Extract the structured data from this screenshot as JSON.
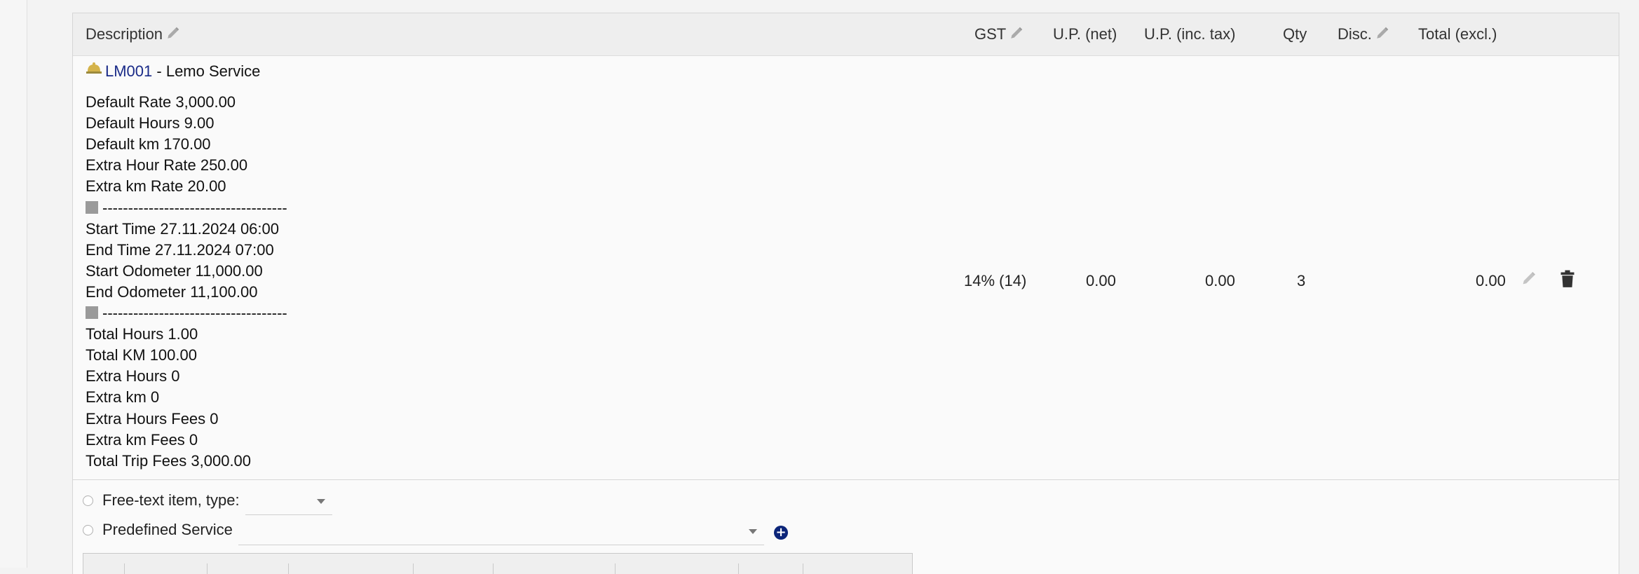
{
  "table": {
    "headers": {
      "description": "Description",
      "gst": "GST",
      "up_net": "U.P. (net)",
      "up_inc_tax": "U.P. (inc. tax)",
      "qty": "Qty",
      "disc": "Disc.",
      "total_excl": "Total (excl.)"
    },
    "row": {
      "product_code": "LM001",
      "product_name": " - Lemo Service",
      "details_1": [
        "Default Rate 3,000.00",
        "Default Hours 9.00",
        "Default km 170.00",
        "Extra Hour Rate 250.00",
        "Extra km Rate 20.00"
      ],
      "separator": "------------------------------------",
      "details_2": [
        "Start Time 27.11.2024 06:00",
        "End Time 27.11.2024 07:00",
        "Start Odometer 11,000.00",
        "End Odometer 11,100.00"
      ],
      "details_3": [
        "Total Hours 1.00",
        "Total KM 100.00",
        "Extra Hours 0",
        "Extra km 0",
        "Extra Hours Fees 0",
        "Extra km Fees 0",
        "Total Trip Fees 3,000.00"
      ],
      "gst": "14% (14)",
      "up_net": "0.00",
      "up_inc_tax": "0.00",
      "qty": "3",
      "disc": "",
      "total_excl": "0.00"
    }
  },
  "add_line": {
    "free_text_label": "Free-text item, type:",
    "free_text_type_value": "",
    "predefined_label": "Predefined Service",
    "predefined_value": ""
  },
  "icons": {
    "product": "service-bell-icon",
    "edit": "pencil-icon",
    "delete": "trash-icon",
    "add": "plus-circle-icon"
  },
  "colors": {
    "link": "#1a2b88",
    "add_button": "#0c2579",
    "header_bg": "#eeeeee"
  }
}
